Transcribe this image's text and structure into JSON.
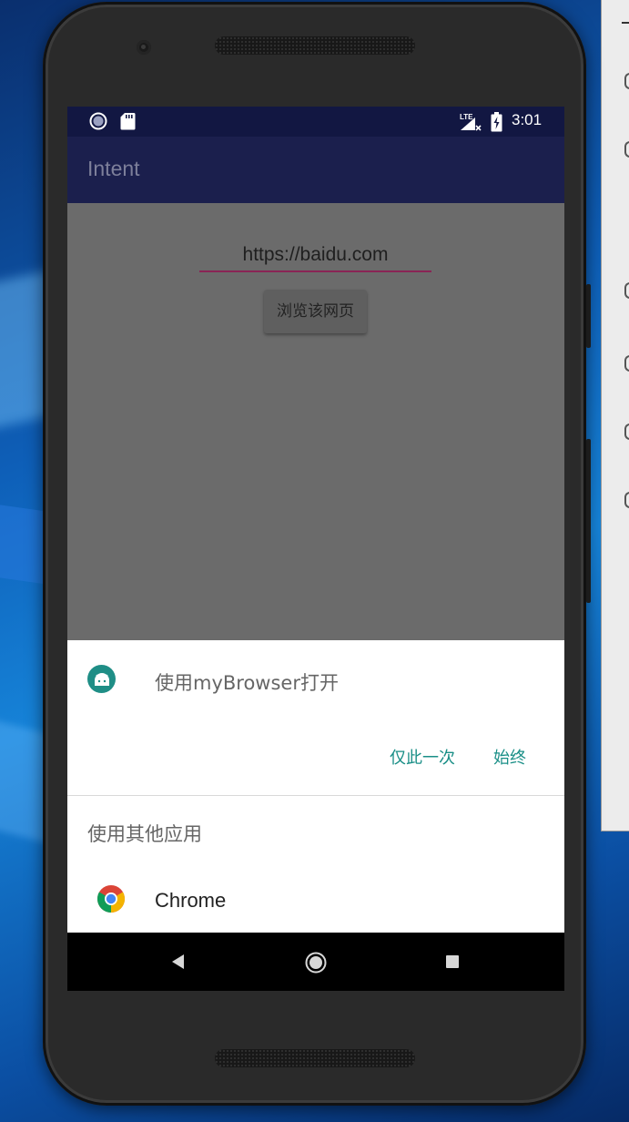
{
  "status_bar": {
    "network_label": "LTE",
    "time": "3:01"
  },
  "app_bar": {
    "title": "Intent"
  },
  "main": {
    "url_input_value": "https://baidu.com",
    "browse_button_label": "浏览该网页"
  },
  "chooser": {
    "open_with_label": "使用myBrowser打开",
    "just_once_label": "仅此一次",
    "always_label": "始终",
    "other_apps_label": "使用其他应用",
    "apps": [
      {
        "label": "Chrome",
        "icon": "chrome-icon"
      }
    ]
  },
  "colors": {
    "status_bar": "#121742",
    "app_bar": "#1b1f4d",
    "dim_content": "#6b6b6b",
    "accent_teal": "#1a8f87",
    "input_underline": "#8a2455",
    "nav_bar": "#000000"
  },
  "icons": [
    "sync-icon",
    "sd-card-icon",
    "lte-signal-icon",
    "battery-charging-icon",
    "android-app-icon",
    "chrome-icon",
    "back-icon",
    "home-icon",
    "recents-icon"
  ]
}
